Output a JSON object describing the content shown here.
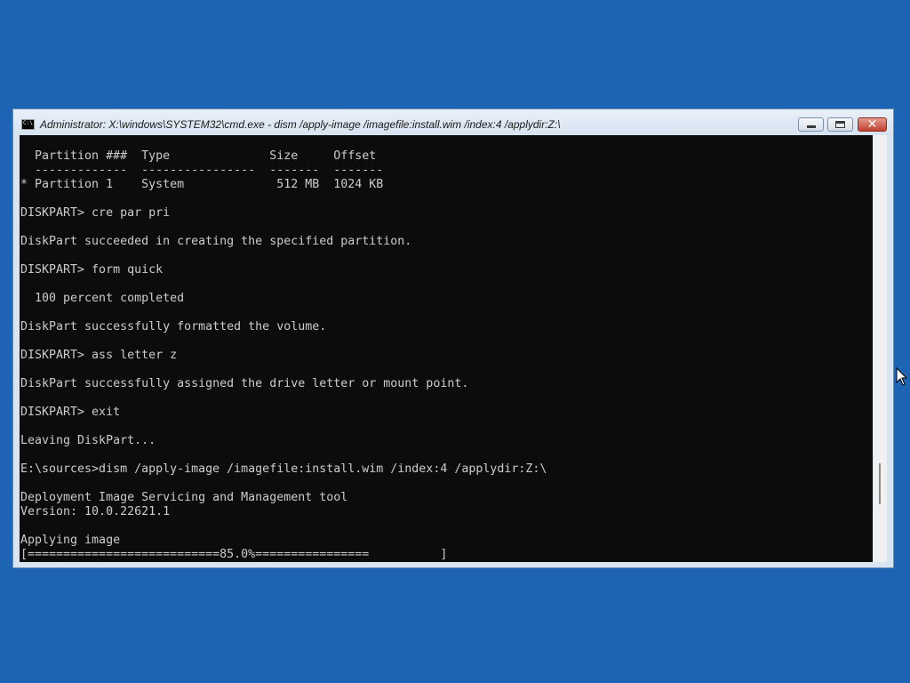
{
  "window": {
    "title": "Administrator: X:\\windows\\SYSTEM32\\cmd.exe - dism  /apply-image /imagefile:install.wim /index:4 /applydir:Z:\\",
    "icon_text": "C:\\",
    "close_glyph": "✕"
  },
  "console": {
    "foreground": "#cccccc",
    "background": "#0c0c0c",
    "lines": [
      "  Partition ###  Type              Size     Offset",
      "  -------------  ----------------  -------  -------",
      "* Partition 1    System             512 MB  1024 KB",
      "",
      "DISKPART> cre par pri",
      "",
      "DiskPart succeeded in creating the specified partition.",
      "",
      "DISKPART> form quick",
      "",
      "  100 percent completed",
      "",
      "DiskPart successfully formatted the volume.",
      "",
      "DISKPART> ass letter z",
      "",
      "DiskPart successfully assigned the drive letter or mount point.",
      "",
      "DISKPART> exit",
      "",
      "Leaving DiskPart...",
      "",
      "E:\\sources>dism /apply-image /imagefile:install.wim /index:4 /applydir:Z:\\",
      "",
      "Deployment Image Servicing and Management tool",
      "Version: 10.0.22621.1",
      "",
      "Applying image",
      "[===========================85.0%================          ]"
    ]
  },
  "progress": {
    "percent": 85.0
  },
  "desktop": {
    "background": "#1d64b4"
  },
  "icons": {
    "app": "cmd-icon",
    "minimize": "minimize-icon",
    "maximize": "maximize-icon",
    "close": "close-icon",
    "cursor": "mouse-pointer-icon"
  }
}
